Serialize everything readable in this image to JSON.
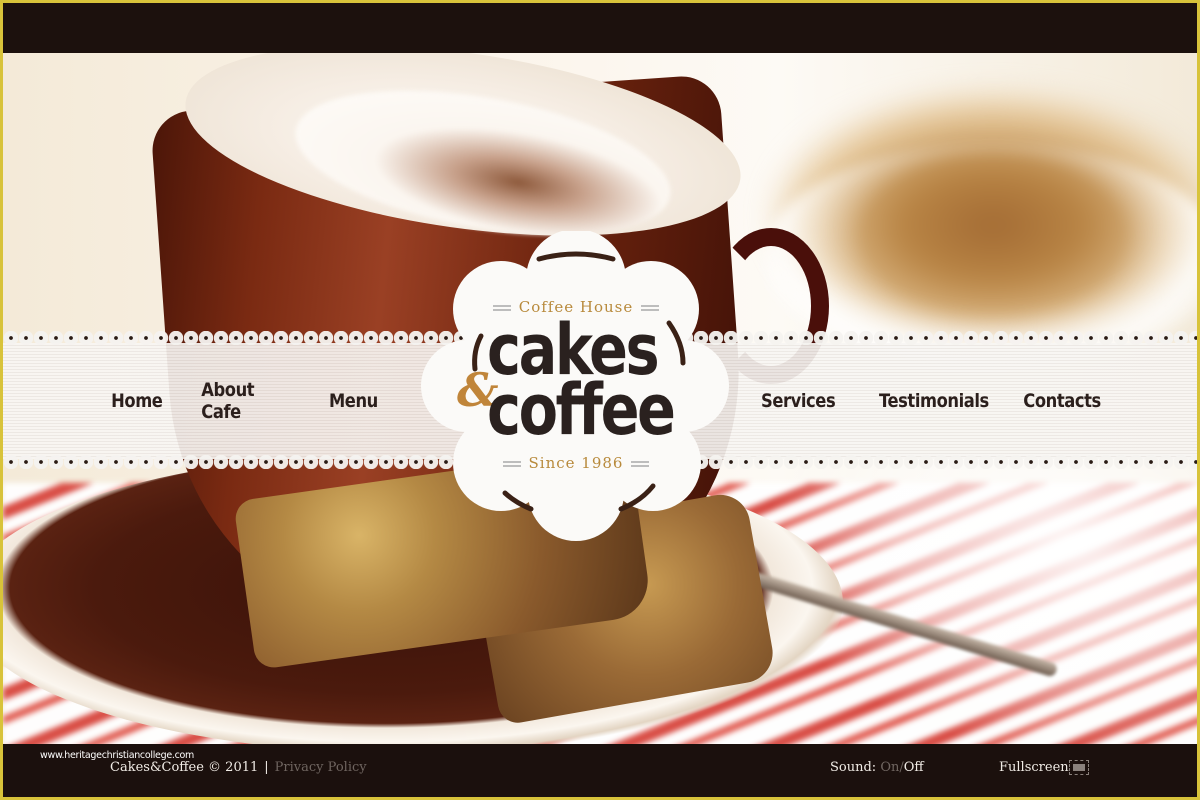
{
  "logo": {
    "tagline_top": "Coffee House",
    "word1": "cakes",
    "ampersand": "&",
    "word2": "coffee",
    "tagline_bottom": "Since 1986"
  },
  "nav": {
    "left": [
      {
        "label": "Home"
      },
      {
        "label": "About Cafe"
      },
      {
        "label": "Menu"
      }
    ],
    "right": [
      {
        "label": "Services"
      },
      {
        "label": "Testimonials"
      },
      {
        "label": "Contacts"
      }
    ]
  },
  "footer": {
    "watermark": "www.heritagechristiancollege.com",
    "copyright": "Cakes&Coffee © 2011",
    "separator": "|",
    "privacy_label": "Privacy Policy",
    "sound_label": "Sound:",
    "sound_on": "On",
    "sound_slash": "/",
    "sound_off": "Off",
    "fullscreen_label": "Fullscreen"
  },
  "colors": {
    "frame": "#d8c33a",
    "bars": "#1c110d",
    "accent_gold": "#b88a3c",
    "nav_text": "#2b1f1c",
    "muted_text": "#6f6560"
  }
}
